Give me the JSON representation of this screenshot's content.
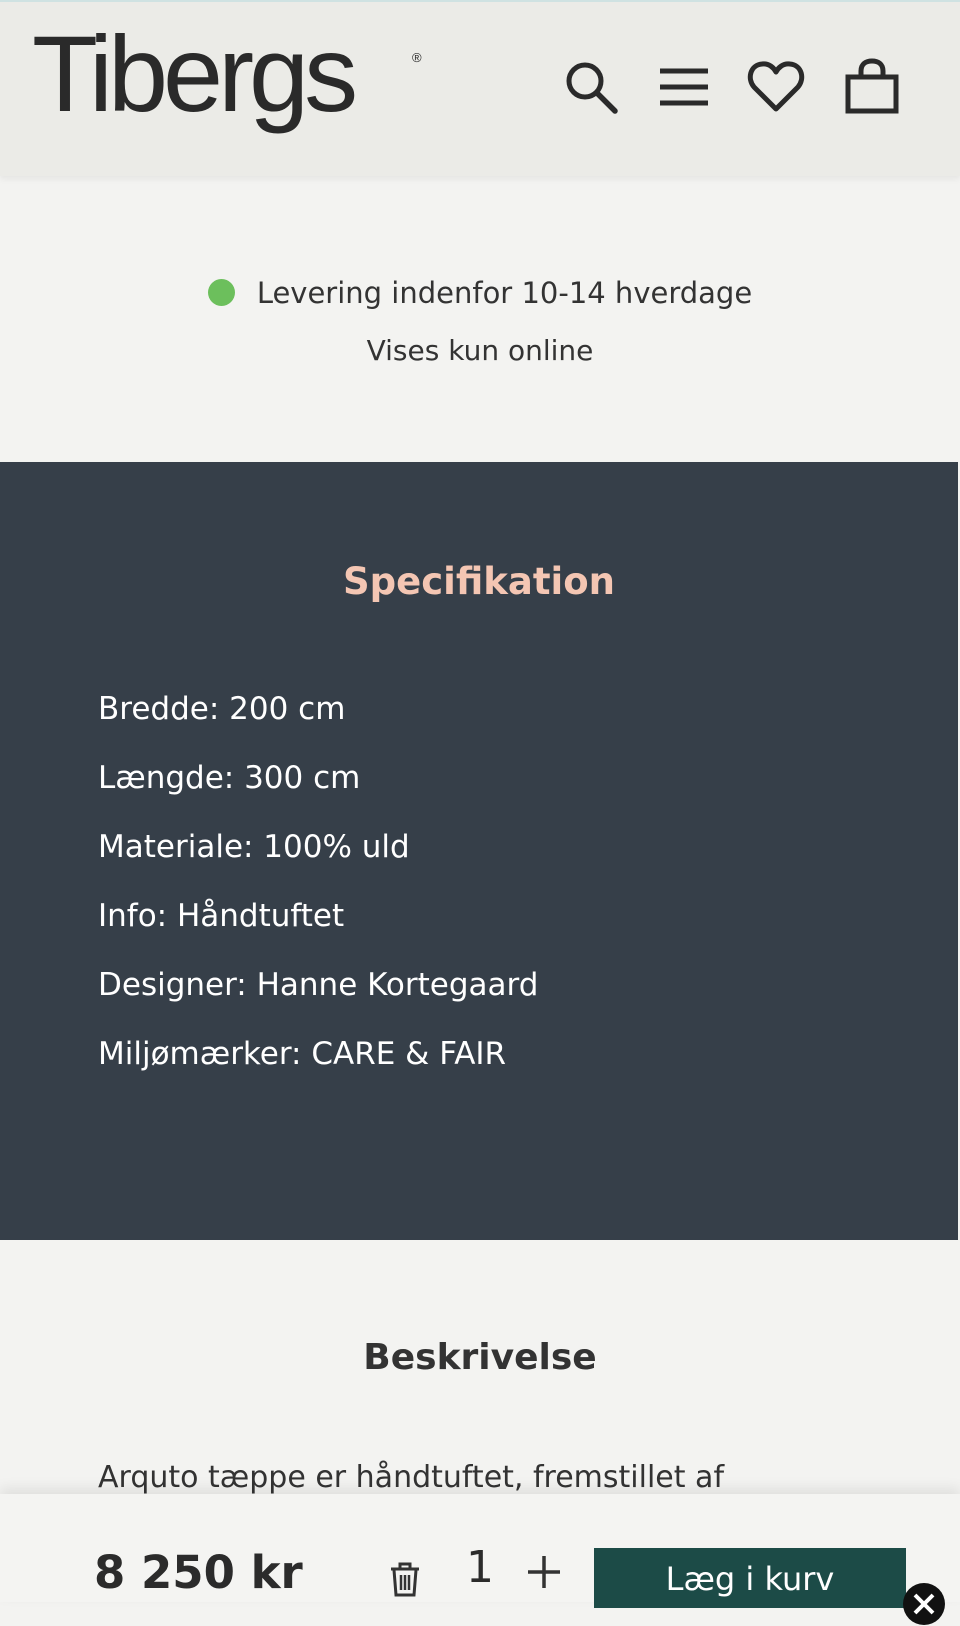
{
  "header": {
    "logo_text": "Tibergs",
    "logo_reg": "®",
    "icons": [
      "search-icon",
      "menu-icon",
      "heart-icon",
      "bag-icon"
    ]
  },
  "availability": {
    "delivery_text": "Levering indenfor 10-14 hverdage",
    "status_color": "#6cbf5c",
    "online_text": "Vises kun online"
  },
  "spec": {
    "title": "Specifikation",
    "items": [
      "Bredde: 200 cm",
      "Længde: 300 cm",
      "Materiale: 100% uld",
      "Info: Håndtuftet",
      "Designer: Hanne Kortegaard",
      "Miljømærker: CARE & FAIR"
    ],
    "background": "#363f49",
    "title_color": "#f4c6b3"
  },
  "description": {
    "title": "Beskrivelse",
    "text": "Arquto tæppe er håndtuftet, fremstillet af"
  },
  "purchase": {
    "price": "8 250 kr",
    "quantity": "1",
    "add_to_cart_label": "Læg i kurv",
    "button_color": "#1c4b47"
  }
}
